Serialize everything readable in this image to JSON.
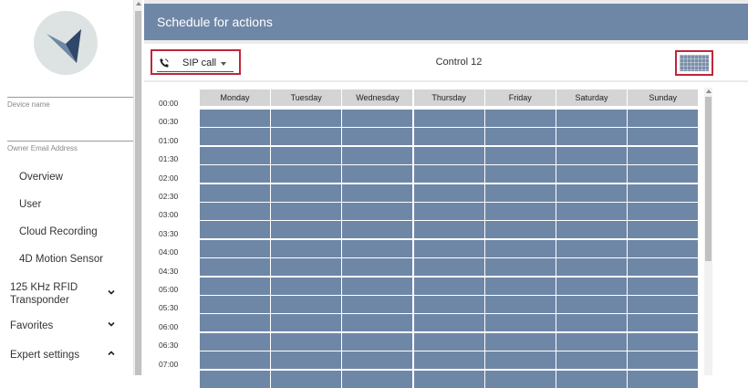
{
  "sidebar": {
    "device_name_label": "Device name",
    "owner_email_label": "Owner Email Address",
    "items": [
      {
        "label": "Overview",
        "chevron": null
      },
      {
        "label": "User",
        "chevron": null
      },
      {
        "label": "Cloud Recording",
        "chevron": null
      },
      {
        "label": "4D Motion Sensor",
        "chevron": null
      },
      {
        "label": "125 KHz RFID Transponder",
        "chevron": "down"
      },
      {
        "label": "Favorites",
        "chevron": "down"
      },
      {
        "label": "Expert settings",
        "chevron": "up"
      }
    ]
  },
  "header": {
    "title": "Schedule for actions"
  },
  "toolbar": {
    "action_select": {
      "value": "SIP call",
      "icon": "phone-icon"
    },
    "control_name": "Control 12",
    "grid_button_icon": "schedule-grid-icon"
  },
  "schedule": {
    "days": [
      "Monday",
      "Tuesday",
      "Wednesday",
      "Thursday",
      "Friday",
      "Saturday",
      "Sunday"
    ],
    "times": [
      "00:00",
      "00:30",
      "01:00",
      "01:30",
      "02:00",
      "02:30",
      "03:00",
      "03:30",
      "04:00",
      "04:30",
      "05:00",
      "05:30",
      "06:00",
      "06:30",
      "07:00"
    ],
    "active_color": "#6f87a6"
  },
  "colors": {
    "header": "#6f87a6",
    "highlight": "#c0263a"
  }
}
